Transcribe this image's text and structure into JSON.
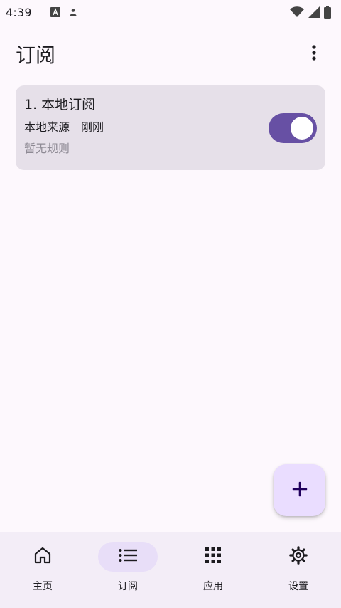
{
  "status_bar": {
    "time": "4:39",
    "icons": [
      "app-notification-icon",
      "account-icon",
      "wifi-icon",
      "signal-icon",
      "battery-icon"
    ]
  },
  "app_bar": {
    "title": "订阅",
    "menu_icon": "more-vert-icon"
  },
  "subscriptions": [
    {
      "name": "1. 本地订阅",
      "source": "本地来源",
      "updated": "刚刚",
      "rules": "暂无规则",
      "enabled": true
    }
  ],
  "fab": {
    "icon": "plus-icon"
  },
  "bottom_nav": {
    "items": [
      {
        "label": "主页",
        "icon": "home-icon",
        "active": false
      },
      {
        "label": "订阅",
        "icon": "list-icon",
        "active": true
      },
      {
        "label": "应用",
        "icon": "apps-grid-icon",
        "active": false
      },
      {
        "label": "设置",
        "icon": "gear-icon",
        "active": false
      }
    ]
  },
  "colors": {
    "background": "#fdf8fd",
    "card": "#e6e0e9",
    "accent": "#6750a4",
    "fab": "#eaddff",
    "nav_bar": "#f3edf7",
    "nav_active_pill": "#e8def8"
  }
}
